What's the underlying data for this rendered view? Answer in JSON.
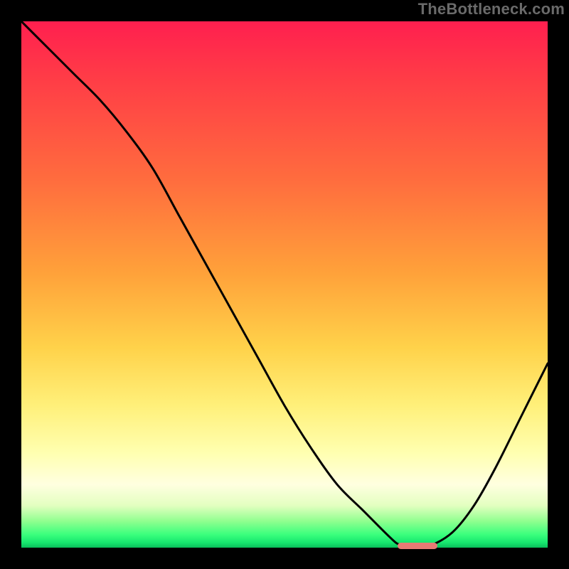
{
  "watermark": "TheBottleneck.com",
  "colors": {
    "background": "#000000",
    "curve_stroke": "#000000",
    "marker": "#e77a74"
  },
  "chart_data": {
    "type": "line",
    "title": "",
    "xlabel": "",
    "ylabel": "",
    "xlim": [
      0,
      100
    ],
    "ylim": [
      0,
      100
    ],
    "series": [
      {
        "name": "bottleneck-curve",
        "x": [
          0,
          5,
          10,
          15,
          20,
          25,
          30,
          35,
          40,
          45,
          50,
          55,
          60,
          65,
          70,
          72,
          75,
          78,
          82,
          86,
          90,
          95,
          100
        ],
        "y": [
          100,
          95,
          90,
          85,
          79,
          72,
          63,
          54,
          45,
          36,
          27,
          19,
          12,
          7,
          2,
          0.5,
          0,
          0.5,
          3,
          8,
          15,
          25,
          35
        ]
      }
    ],
    "markers": [
      {
        "name": "optimal-zone",
        "x_start": 71.5,
        "x_end": 79,
        "y": 0
      }
    ],
    "grid": false,
    "legend": false
  }
}
